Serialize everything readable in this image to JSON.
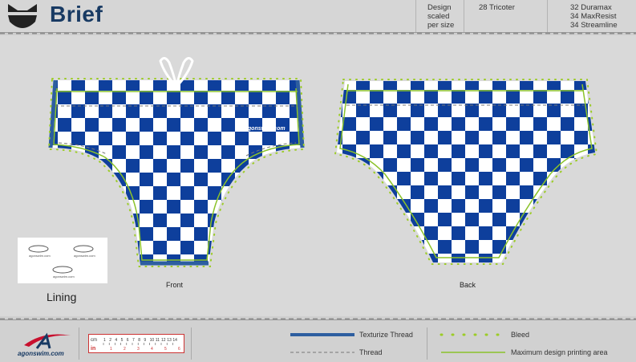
{
  "header": {
    "title": "Brief",
    "design_note": [
      "Design",
      "scaled",
      "per size"
    ],
    "tricoter": "28 Tricoter",
    "fabrics": [
      "32 Duramax",
      "34 MaxResist",
      "34 Streamline"
    ]
  },
  "views": {
    "front_label": "Front",
    "back_label": "Back",
    "front_print": "agonswim.com"
  },
  "lining": {
    "label": "Lining",
    "print": "agonswim.com"
  },
  "footer": {
    "brand": "agonswim.com",
    "ruler_unit_cm": "cm",
    "ruler_unit_in": "in",
    "ruler_ticks": [
      "1",
      "2",
      "4",
      "5",
      "6",
      "7",
      "8",
      "9",
      "10",
      "11",
      "12",
      "13",
      "14"
    ],
    "ruler_inch_ticks": [
      "1",
      "2",
      "3",
      "4",
      "5",
      "6"
    ],
    "legend": {
      "texturize": "Texturize Thread",
      "thread": "Thread",
      "bleed": "Bleed",
      "max_area": "Maximum design printing area"
    }
  },
  "colors": {
    "check_blue": "#0e3f9c",
    "check_white": "#ffffff",
    "bleed_green": "#9ccc27",
    "texturize_blue": "#2d5ea0",
    "title_navy": "#183a63"
  }
}
